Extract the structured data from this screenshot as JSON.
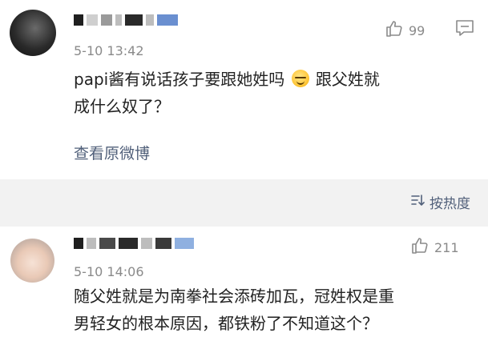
{
  "comments": [
    {
      "time": "5-10 13:42",
      "likes": "99",
      "text_line1a": "papi酱有说话孩子要跟她姓吗",
      "text_line1b": "跟父姓就",
      "text_line2": "成什么奴了？",
      "link": "查看原微博",
      "emoji": "sleepy-smile-emoji"
    },
    {
      "time": "5-10 14:06",
      "likes": "211",
      "text_line1": "随父姓就是为南拳社会添砖加瓦，冠姓权是重",
      "text_line2": "男轻女的根本原因，都铁粉了不知道这个？"
    }
  ],
  "sort": {
    "label": "按热度"
  },
  "colors": {
    "accent": "#51607a",
    "muted": "#8a8a8a",
    "divider_bg": "#f2f2f2"
  }
}
